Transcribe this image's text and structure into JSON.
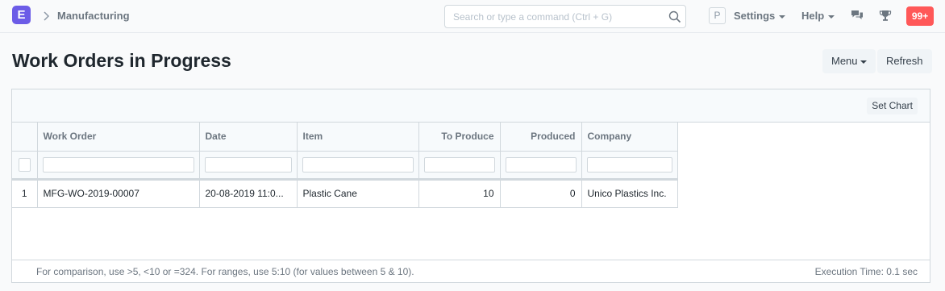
{
  "navbar": {
    "logo_letter": "E",
    "breadcrumb": "Manufacturing",
    "search_placeholder": "Search or type a command (Ctrl + G)",
    "avatar_letter": "P",
    "settings_label": "Settings",
    "help_label": "Help",
    "notification_count": "99+"
  },
  "page": {
    "title": "Work Orders in Progress",
    "menu_label": "Menu",
    "refresh_label": "Refresh"
  },
  "report": {
    "set_chart_label": "Set Chart",
    "columns": [
      "Work Order",
      "Date",
      "Item",
      "To Produce",
      "Produced",
      "Company"
    ],
    "rows": [
      {
        "index": "1",
        "work_order": "MFG-WO-2019-00007",
        "date": "20-08-2019 11:0...",
        "item": "Plastic Cane",
        "to_produce": "10",
        "produced": "0",
        "company": "Unico Plastics Inc."
      }
    ],
    "footer_hint": "For comparison, use >5, <10 or =324. For ranges, use 5:10 (for values between 5 & 10).",
    "execution_time": "Execution Time: 0.1 sec"
  },
  "colors": {
    "logo": "#6c5ce7",
    "notification": "#ff5858"
  }
}
